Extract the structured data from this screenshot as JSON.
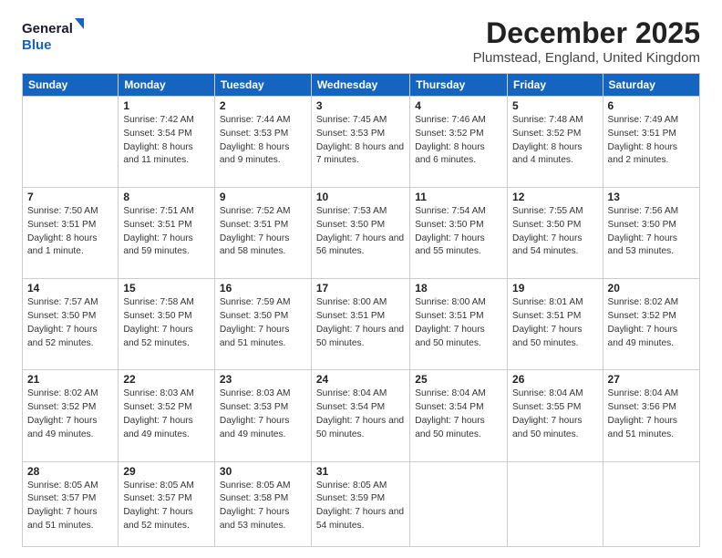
{
  "logo": {
    "line1": "General",
    "line2": "Blue"
  },
  "header": {
    "month": "December 2025",
    "location": "Plumstead, England, United Kingdom"
  },
  "days_of_week": [
    "Sunday",
    "Monday",
    "Tuesday",
    "Wednesday",
    "Thursday",
    "Friday",
    "Saturday"
  ],
  "weeks": [
    [
      {
        "day": "",
        "sunrise": "",
        "sunset": "",
        "daylight": ""
      },
      {
        "day": "1",
        "sunrise": "Sunrise: 7:42 AM",
        "sunset": "Sunset: 3:54 PM",
        "daylight": "Daylight: 8 hours and 11 minutes."
      },
      {
        "day": "2",
        "sunrise": "Sunrise: 7:44 AM",
        "sunset": "Sunset: 3:53 PM",
        "daylight": "Daylight: 8 hours and 9 minutes."
      },
      {
        "day": "3",
        "sunrise": "Sunrise: 7:45 AM",
        "sunset": "Sunset: 3:53 PM",
        "daylight": "Daylight: 8 hours and 7 minutes."
      },
      {
        "day": "4",
        "sunrise": "Sunrise: 7:46 AM",
        "sunset": "Sunset: 3:52 PM",
        "daylight": "Daylight: 8 hours and 6 minutes."
      },
      {
        "day": "5",
        "sunrise": "Sunrise: 7:48 AM",
        "sunset": "Sunset: 3:52 PM",
        "daylight": "Daylight: 8 hours and 4 minutes."
      },
      {
        "day": "6",
        "sunrise": "Sunrise: 7:49 AM",
        "sunset": "Sunset: 3:51 PM",
        "daylight": "Daylight: 8 hours and 2 minutes."
      }
    ],
    [
      {
        "day": "7",
        "sunrise": "Sunrise: 7:50 AM",
        "sunset": "Sunset: 3:51 PM",
        "daylight": "Daylight: 8 hours and 1 minute."
      },
      {
        "day": "8",
        "sunrise": "Sunrise: 7:51 AM",
        "sunset": "Sunset: 3:51 PM",
        "daylight": "Daylight: 7 hours and 59 minutes."
      },
      {
        "day": "9",
        "sunrise": "Sunrise: 7:52 AM",
        "sunset": "Sunset: 3:51 PM",
        "daylight": "Daylight: 7 hours and 58 minutes."
      },
      {
        "day": "10",
        "sunrise": "Sunrise: 7:53 AM",
        "sunset": "Sunset: 3:50 PM",
        "daylight": "Daylight: 7 hours and 56 minutes."
      },
      {
        "day": "11",
        "sunrise": "Sunrise: 7:54 AM",
        "sunset": "Sunset: 3:50 PM",
        "daylight": "Daylight: 7 hours and 55 minutes."
      },
      {
        "day": "12",
        "sunrise": "Sunrise: 7:55 AM",
        "sunset": "Sunset: 3:50 PM",
        "daylight": "Daylight: 7 hours and 54 minutes."
      },
      {
        "day": "13",
        "sunrise": "Sunrise: 7:56 AM",
        "sunset": "Sunset: 3:50 PM",
        "daylight": "Daylight: 7 hours and 53 minutes."
      }
    ],
    [
      {
        "day": "14",
        "sunrise": "Sunrise: 7:57 AM",
        "sunset": "Sunset: 3:50 PM",
        "daylight": "Daylight: 7 hours and 52 minutes."
      },
      {
        "day": "15",
        "sunrise": "Sunrise: 7:58 AM",
        "sunset": "Sunset: 3:50 PM",
        "daylight": "Daylight: 7 hours and 52 minutes."
      },
      {
        "day": "16",
        "sunrise": "Sunrise: 7:59 AM",
        "sunset": "Sunset: 3:50 PM",
        "daylight": "Daylight: 7 hours and 51 minutes."
      },
      {
        "day": "17",
        "sunrise": "Sunrise: 8:00 AM",
        "sunset": "Sunset: 3:51 PM",
        "daylight": "Daylight: 7 hours and 50 minutes."
      },
      {
        "day": "18",
        "sunrise": "Sunrise: 8:00 AM",
        "sunset": "Sunset: 3:51 PM",
        "daylight": "Daylight: 7 hours and 50 minutes."
      },
      {
        "day": "19",
        "sunrise": "Sunrise: 8:01 AM",
        "sunset": "Sunset: 3:51 PM",
        "daylight": "Daylight: 7 hours and 50 minutes."
      },
      {
        "day": "20",
        "sunrise": "Sunrise: 8:02 AM",
        "sunset": "Sunset: 3:52 PM",
        "daylight": "Daylight: 7 hours and 49 minutes."
      }
    ],
    [
      {
        "day": "21",
        "sunrise": "Sunrise: 8:02 AM",
        "sunset": "Sunset: 3:52 PM",
        "daylight": "Daylight: 7 hours and 49 minutes."
      },
      {
        "day": "22",
        "sunrise": "Sunrise: 8:03 AM",
        "sunset": "Sunset: 3:52 PM",
        "daylight": "Daylight: 7 hours and 49 minutes."
      },
      {
        "day": "23",
        "sunrise": "Sunrise: 8:03 AM",
        "sunset": "Sunset: 3:53 PM",
        "daylight": "Daylight: 7 hours and 49 minutes."
      },
      {
        "day": "24",
        "sunrise": "Sunrise: 8:04 AM",
        "sunset": "Sunset: 3:54 PM",
        "daylight": "Daylight: 7 hours and 50 minutes."
      },
      {
        "day": "25",
        "sunrise": "Sunrise: 8:04 AM",
        "sunset": "Sunset: 3:54 PM",
        "daylight": "Daylight: 7 hours and 50 minutes."
      },
      {
        "day": "26",
        "sunrise": "Sunrise: 8:04 AM",
        "sunset": "Sunset: 3:55 PM",
        "daylight": "Daylight: 7 hours and 50 minutes."
      },
      {
        "day": "27",
        "sunrise": "Sunrise: 8:04 AM",
        "sunset": "Sunset: 3:56 PM",
        "daylight": "Daylight: 7 hours and 51 minutes."
      }
    ],
    [
      {
        "day": "28",
        "sunrise": "Sunrise: 8:05 AM",
        "sunset": "Sunset: 3:57 PM",
        "daylight": "Daylight: 7 hours and 51 minutes."
      },
      {
        "day": "29",
        "sunrise": "Sunrise: 8:05 AM",
        "sunset": "Sunset: 3:57 PM",
        "daylight": "Daylight: 7 hours and 52 minutes."
      },
      {
        "day": "30",
        "sunrise": "Sunrise: 8:05 AM",
        "sunset": "Sunset: 3:58 PM",
        "daylight": "Daylight: 7 hours and 53 minutes."
      },
      {
        "day": "31",
        "sunrise": "Sunrise: 8:05 AM",
        "sunset": "Sunset: 3:59 PM",
        "daylight": "Daylight: 7 hours and 54 minutes."
      },
      {
        "day": "",
        "sunrise": "",
        "sunset": "",
        "daylight": ""
      },
      {
        "day": "",
        "sunrise": "",
        "sunset": "",
        "daylight": ""
      },
      {
        "day": "",
        "sunrise": "",
        "sunset": "",
        "daylight": ""
      }
    ]
  ]
}
